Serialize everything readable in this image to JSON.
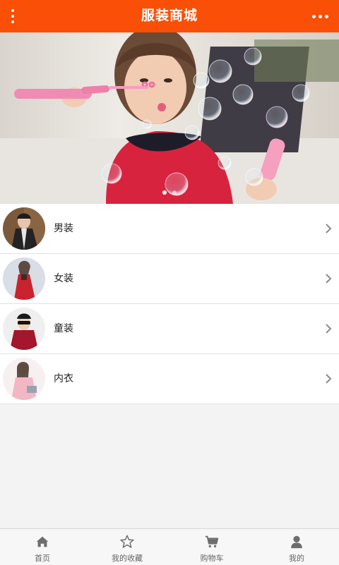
{
  "header": {
    "title": "服装商城",
    "left_icon": "vertical-dots-menu-icon",
    "right_icon": "horizontal-dots-more-icon",
    "accent": "#fa4f06"
  },
  "banner": {
    "slides": 2,
    "active_slide": 1
  },
  "categories": [
    {
      "label": "男装",
      "icon": "chevron-right-icon"
    },
    {
      "label": "女装",
      "icon": "chevron-right-icon"
    },
    {
      "label": "童装",
      "icon": "chevron-right-icon"
    },
    {
      "label": "内衣",
      "icon": "chevron-right-icon"
    }
  ],
  "tabbar": [
    {
      "label": "首页",
      "icon": "home-icon"
    },
    {
      "label": "我的收藏",
      "icon": "star-icon"
    },
    {
      "label": "购物车",
      "icon": "cart-icon"
    },
    {
      "label": "我的",
      "icon": "user-icon"
    }
  ]
}
